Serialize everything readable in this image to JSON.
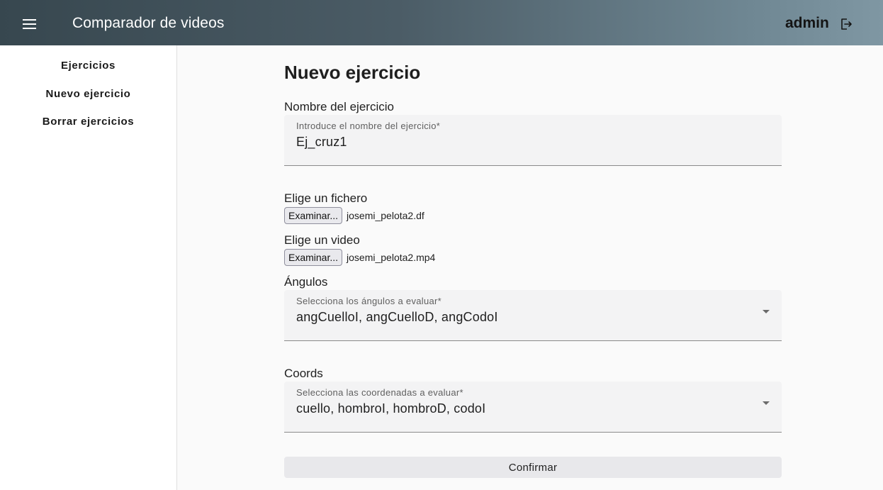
{
  "toolbar": {
    "title": "Comparador de videos",
    "user": "admin",
    "menu_icon": "menu-icon",
    "logout_icon": "logout-icon"
  },
  "sidebar": {
    "items": [
      {
        "label": "Ejercicios"
      },
      {
        "label": "Nuevo ejercicio"
      },
      {
        "label": "Borrar ejercicios"
      }
    ]
  },
  "form": {
    "title": "Nuevo ejercicio",
    "name_section": "Nombre del ejercicio",
    "name_float": "Introduce el nombre del ejercicio*",
    "name_value": "Ej_cruz1",
    "file_section": "Elige un fichero",
    "file_button": "Examinar...",
    "file_name": "josemi_pelota2.df",
    "video_section": "Elige un video",
    "video_button": "Examinar...",
    "video_name": "josemi_pelota2.mp4",
    "angles_section": "Ángulos",
    "angles_float": "Selecciona los ángulos a evaluar*",
    "angles_value": "angCuelloI, angCuelloD, angCodoI",
    "coords_section": "Coords",
    "coords_float": "Selecciona las coordenadas a evaluar*",
    "coords_value": "cuello, hombroI, hombroD, codoI",
    "confirm_label": "Confirmar"
  },
  "colors": {
    "toolbar_start": "#37474f",
    "toolbar_end": "#7f97a3",
    "background": "#fafafa",
    "field_background": "#f3f3f4"
  }
}
